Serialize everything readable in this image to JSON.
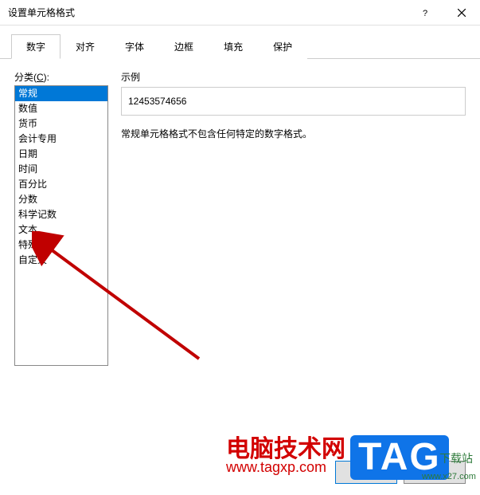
{
  "window": {
    "title": "设置单元格格式"
  },
  "tabs": {
    "items": [
      "数字",
      "对齐",
      "字体",
      "边框",
      "填充",
      "保护"
    ],
    "active": 0
  },
  "category": {
    "label_prefix": "分类(",
    "label_key": "C",
    "label_suffix": "):",
    "items": [
      "常规",
      "数值",
      "货币",
      "会计专用",
      "日期",
      "时间",
      "百分比",
      "分数",
      "科学记数",
      "文本",
      "特殊",
      "自定义"
    ],
    "selected": 0
  },
  "sample": {
    "label": "示例",
    "value": "12453574656"
  },
  "description": "常规单元格格式不包含任何特定的数字格式。",
  "buttons": {
    "ok": "确定",
    "cancel": "取消"
  },
  "watermark": {
    "line1": "电脑技术网",
    "line2": "www.tagxp.com",
    "tag": "TAG",
    "side1": "下载站",
    "side2": "www.x27.com"
  }
}
